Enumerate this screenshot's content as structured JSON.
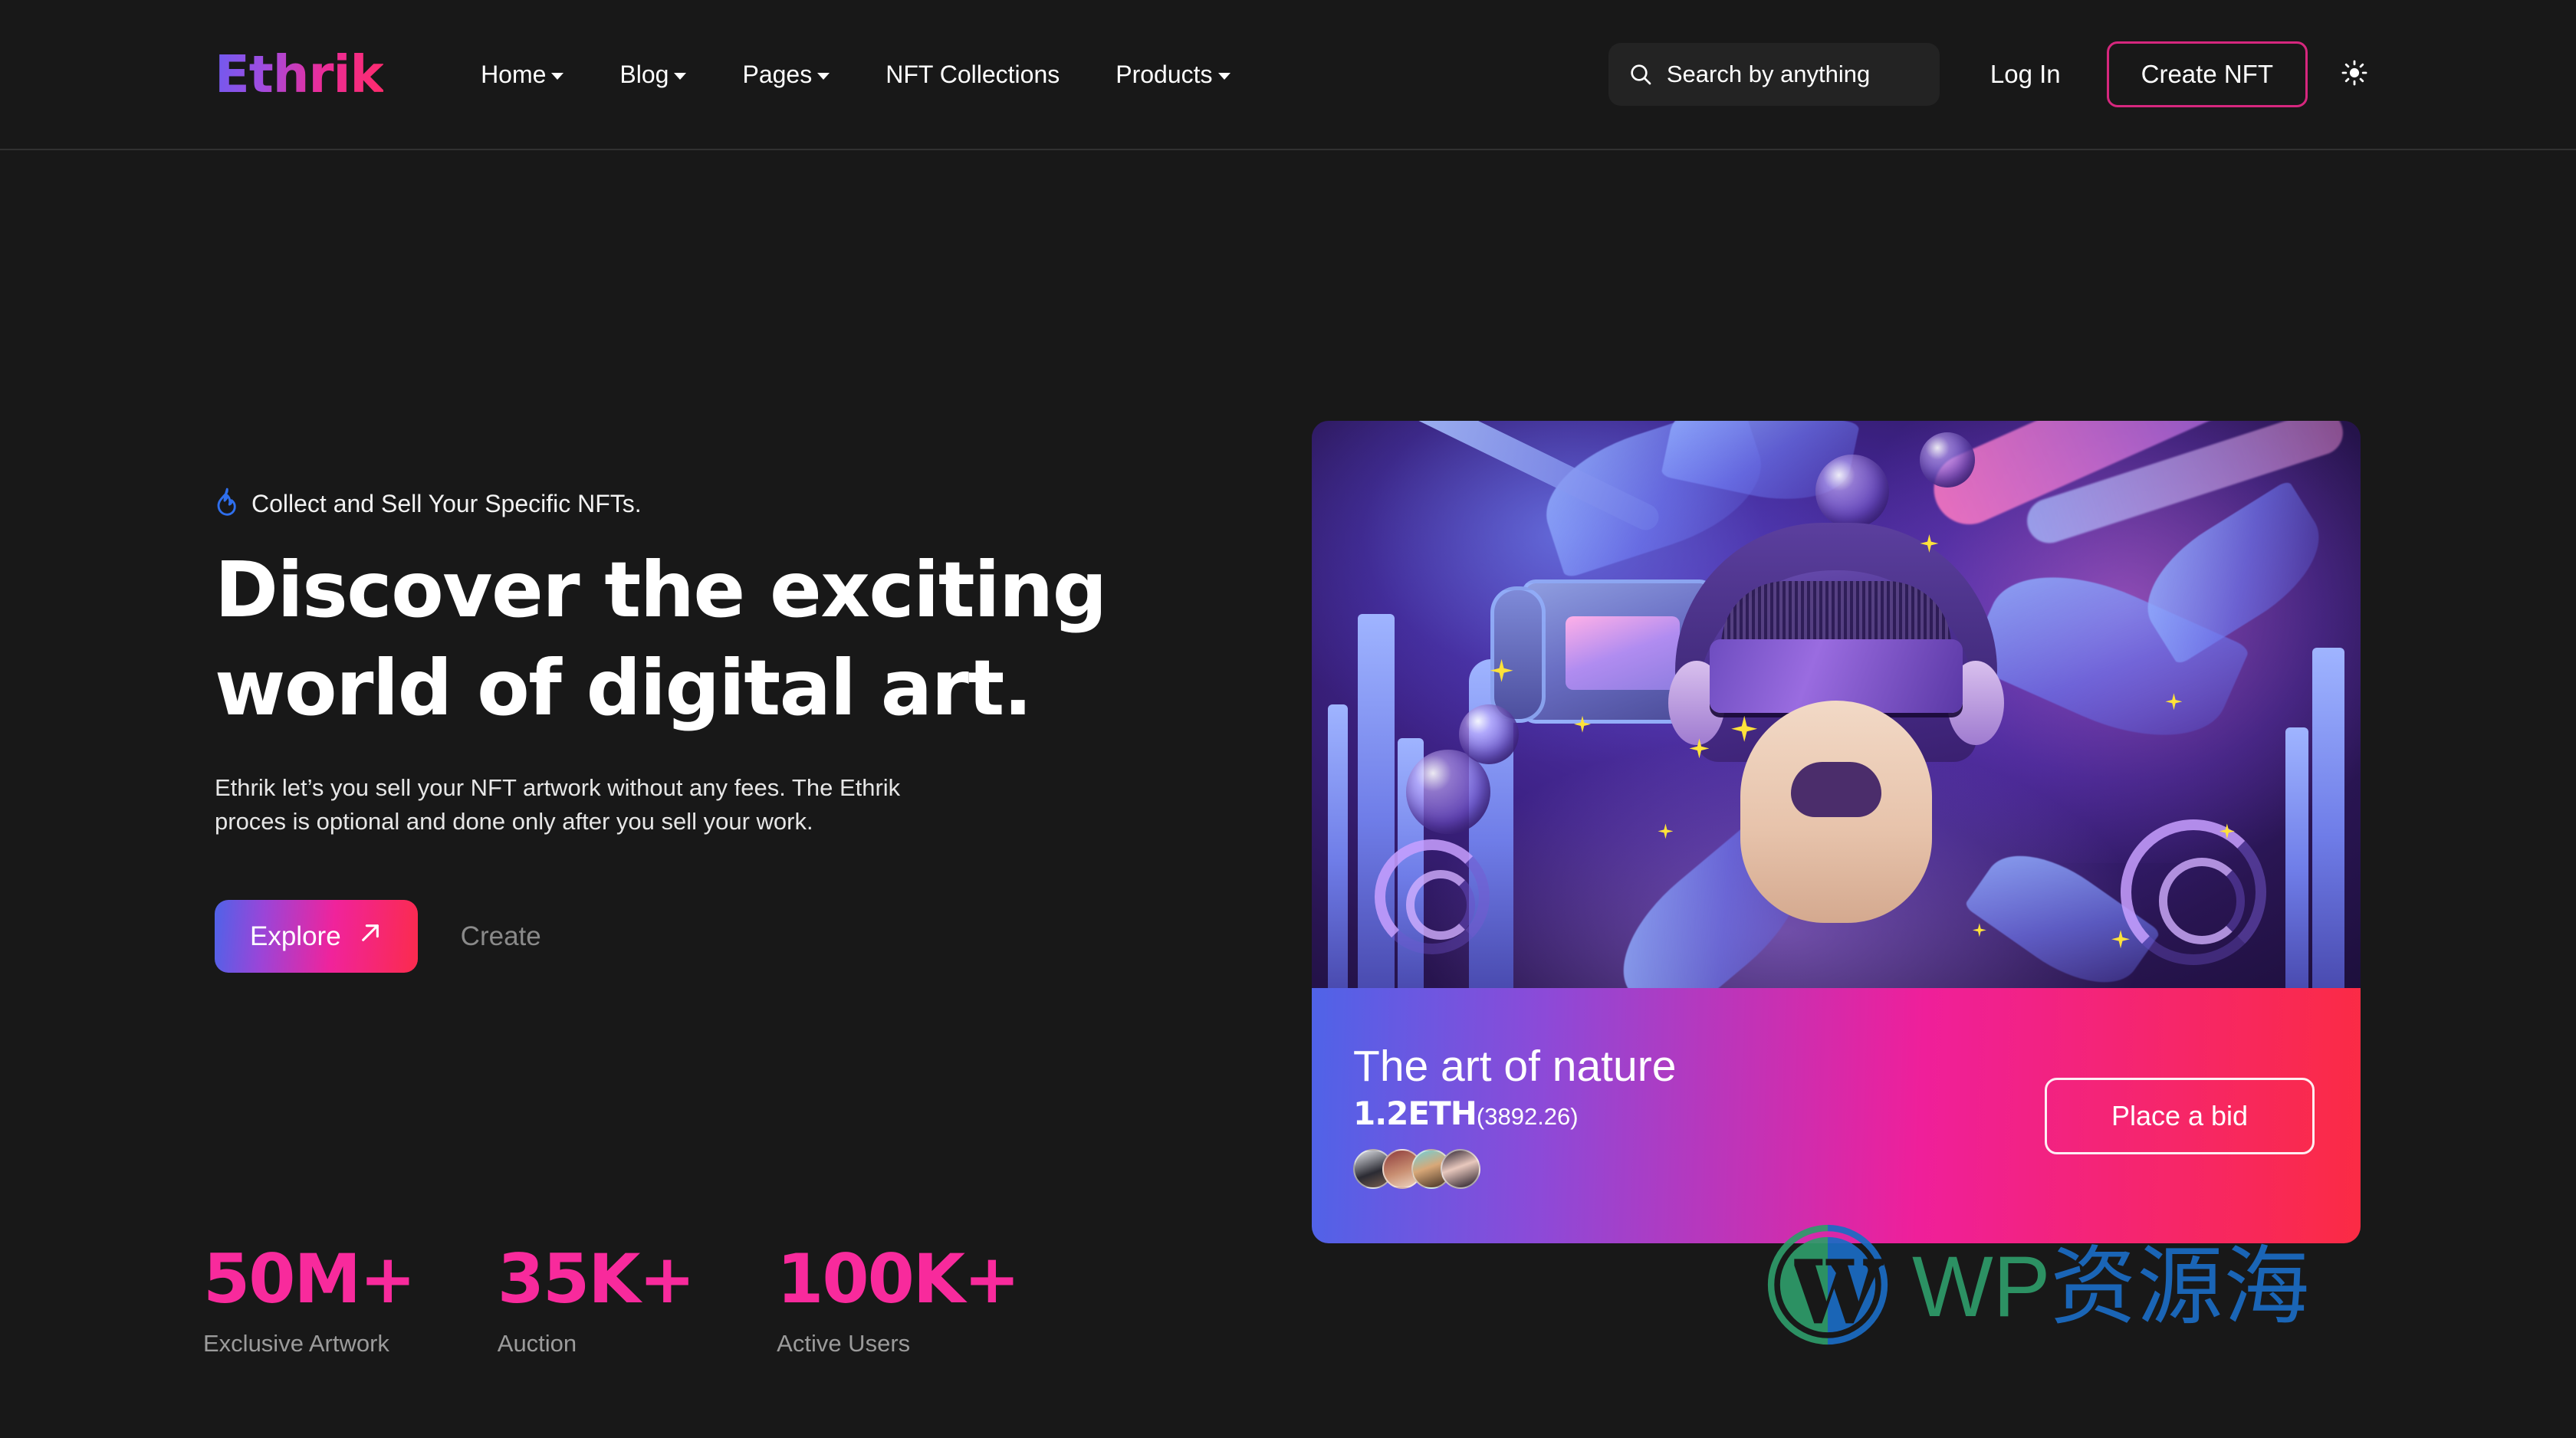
{
  "header": {
    "brand": "Ethrik",
    "nav": [
      {
        "label": "Home",
        "has_dropdown": true
      },
      {
        "label": "Blog",
        "has_dropdown": true
      },
      {
        "label": "Pages",
        "has_dropdown": true
      },
      {
        "label": "NFT Collections",
        "has_dropdown": false
      },
      {
        "label": "Products",
        "has_dropdown": true
      }
    ],
    "search": {
      "placeholder": "Search by anything",
      "value": "",
      "icon": "search-icon"
    },
    "login_label": "Log In",
    "create_nft_label": "Create NFT",
    "theme_toggle_icon": "sun-icon"
  },
  "hero": {
    "eyebrow_icon": "flame-icon",
    "eyebrow": "Collect and Sell Your Specific NFTs.",
    "title_line1": "Discover the exciting",
    "title_line2": "world of digital art.",
    "description_line1": "Ethrik let’s you sell your NFT artwork without any fees. The Ethrik",
    "description_line2": "proces is optional and done only after you sell your work.",
    "explore_label": "Explore",
    "explore_icon": "arrow-up-right-icon",
    "create_label": "Create"
  },
  "nft_card": {
    "artwork_alt": "vr-headset-cosmic-artwork",
    "title": "The art of nature",
    "price": "1.2ETH",
    "price_usd": "(3892.26)",
    "bidders_count": 4,
    "place_bid_label": "Place a bid"
  },
  "stats": [
    {
      "value": "50M+",
      "label": "Exclusive Artwork"
    },
    {
      "value": "35K+",
      "label": "Auction"
    },
    {
      "value": "100K+",
      "label": "Active Users"
    }
  ],
  "watermark": {
    "logo_icon": "wordpress-logo-icon",
    "text_wp": "WP",
    "text_cn": "资源海"
  },
  "colors": {
    "page_bg": "#181818",
    "accent_pink": "#f82a9c",
    "accent_magenta": "#d6277e",
    "accent_blue": "#2f6fed",
    "gradient_start": "#4f63e8",
    "gradient_mid": "#ef1f9a",
    "gradient_end": "#fb2b44",
    "watermark_green": "#2e9c6a",
    "watermark_blue": "#1b6cc4"
  }
}
